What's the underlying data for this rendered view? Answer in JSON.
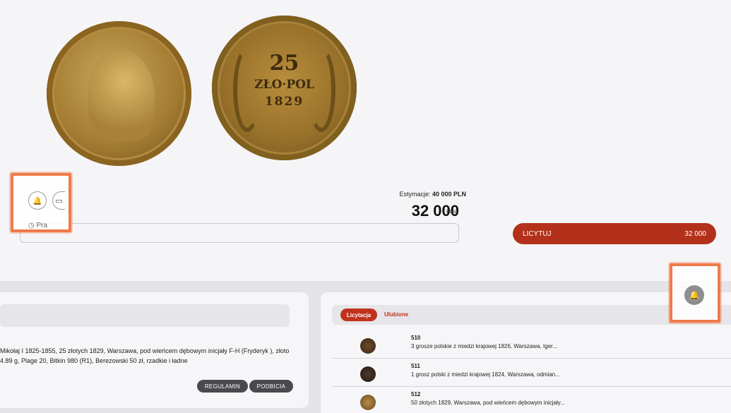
{
  "colors": {
    "accent": "#c0321d",
    "bid_button": "#b3311b",
    "highlight": "#f07a4a"
  },
  "coin_reverse": {
    "denomination": "25",
    "line2": "ZŁO·POL",
    "year": "1829"
  },
  "estimate": {
    "label": "Estymacje:",
    "value": "40 000 PLN"
  },
  "price": {
    "value": "32 000",
    "currency": "PLN"
  },
  "search": {
    "placeholder": "Pra"
  },
  "bid_button": {
    "label": "LICYTUJ",
    "amount": "32 000"
  },
  "icons": {
    "observe": "bell-icon",
    "wallet": "card-icon",
    "notify": "bell-icon"
  },
  "description": {
    "text": "Mikołaj I 1825-1855, 25 złotych 1829, Warszawa, pod wieńcem dębowym inicjały F-H (Fryderyk ), złoto 4.89 g, Plage 20, Bitkin 980 (R1), Berezowski 50 zł, rzadkie i ładne",
    "buttons": [
      "REGULAMIN",
      "PODBICIA"
    ]
  },
  "tabs": [
    "Licytacja",
    "Ulubione"
  ],
  "lots": [
    {
      "number": "510",
      "title": "3 grosze polskie z miedzi krajowej 1826, Warszawa, Iger..."
    },
    {
      "number": "511",
      "title": "1 grosz polski z miedzi krajowej 1824, Warszawa, odmian..."
    },
    {
      "number": "512",
      "title": "50 złotych 1829, Warszawa, pod wieńcem dębowym inicjały..."
    }
  ]
}
